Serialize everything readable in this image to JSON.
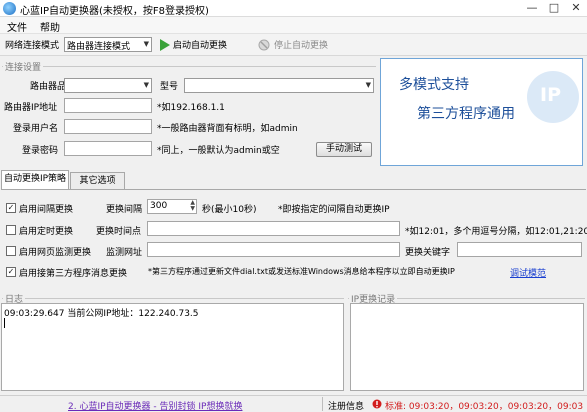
{
  "window": {
    "title": "心蓝IP自动更换器(未授权，按F8登录授权)",
    "icon": "app-logo-icon",
    "controls": [
      "minimize-icon",
      "maximize-icon",
      "close-icon"
    ]
  },
  "menu": {
    "items": [
      "文件",
      "帮助"
    ]
  },
  "toolbar": {
    "mode_label": "网络连接模式",
    "mode_value": "路由器连接模式",
    "start_label": "启动自动更换",
    "stop_label": "停止自动更换"
  },
  "connection": {
    "group_title": "连接设置",
    "brand_label": "路由器品牌",
    "brand_value": "",
    "model_label": "型号",
    "model_value": "",
    "ip_label": "路由器IP地址",
    "ip_value": "",
    "ip_hint": "*如192.168.1.1",
    "user_label": "登录用户名",
    "user_value": "",
    "user_hint": "*一般路由器背面有标明，如admin",
    "pwd_label": "登录密码",
    "pwd_value": "",
    "pwd_hint": "*同上，一般默认为admin或空",
    "test_button": "手动测试"
  },
  "ad": {
    "line1": "多模式支持",
    "line2": "第三方程序通用",
    "logo_text": "IP"
  },
  "tabs": [
    {
      "label": "自动更换IP策略",
      "active": true
    },
    {
      "label": "其它选项",
      "active": false
    }
  ],
  "strategy": {
    "interval_check": "启用间隔更换",
    "interval_checked": true,
    "interval_label": "更换间隔",
    "interval_value": "300",
    "interval_unit": "秒(最小10秒)",
    "interval_hint": "*即按指定的间隔自动更换IP",
    "timed_check": "启用定时更换",
    "timed_checked": false,
    "timed_label": "更换时间点",
    "timed_value": "",
    "timed_hint": "*如12:01，多个用逗号分隔，如12:01,21:20",
    "web_check": "启用网页监测更换",
    "web_checked": false,
    "web_label": "监测网址",
    "web_value": "",
    "keyword_label": "更换关键字",
    "keyword_value": "",
    "msg_check": "启用接第三方程序消息更换",
    "msg_checked": true,
    "msg_hint": "*第三方程序通过更新文件dial.txt或发送标准Windows消息给本程序以立即自动更换IP",
    "example_link": "调试模范"
  },
  "log": {
    "title": "日志",
    "lines": [
      "09:03:29.647 当前公网IP地址：122.240.73.5"
    ]
  },
  "ip_records": {
    "title": "IP更换记录"
  },
  "status": {
    "link": "2. 心蓝IP自动更换器 - 告别封锁 IP想换就换",
    "reg_label": "注册信息",
    "info_text": "标准: 09:03:20，09:03:20，09:03:20，09:03:20"
  },
  "colors": {
    "accent_blue": "#1d4f9a",
    "link_purple": "#6a2bb8",
    "status_red": "#d21d1d",
    "ad_border": "#6fa5d8"
  }
}
